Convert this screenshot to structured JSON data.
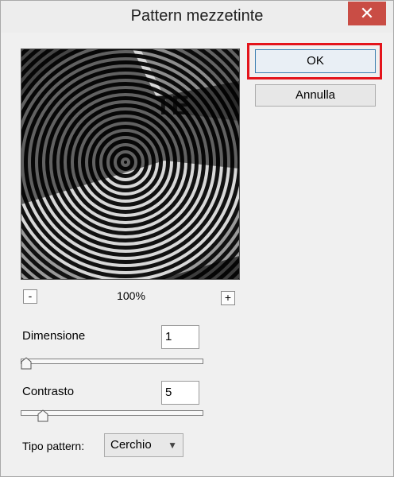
{
  "dialog": {
    "title": "Pattern mezzetinte",
    "close_icon": "close-x-icon"
  },
  "preview": {
    "zoom_out_label": "-",
    "zoom_in_label": "+",
    "zoom_level": "100%"
  },
  "buttons": {
    "ok_label": "OK",
    "cancel_label": "Annulla"
  },
  "size": {
    "label": "Dimensione",
    "value": "1",
    "slider_fraction": 0.0
  },
  "contrast": {
    "label": "Contrasto",
    "value": "5",
    "slider_fraction": 0.1
  },
  "pattern_type": {
    "label": "Tipo pattern:",
    "selected": "Cerchio"
  },
  "colors": {
    "close_button": "#c94d45",
    "highlight": "#e4141b",
    "focus_border": "#3c7fb1"
  }
}
